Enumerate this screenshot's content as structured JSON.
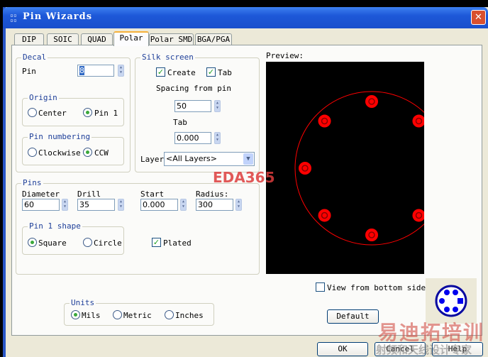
{
  "window": {
    "title": "Pin Wizards",
    "close": "✕"
  },
  "tabs": [
    {
      "label": "DIP"
    },
    {
      "label": "SOIC"
    },
    {
      "label": "QUAD"
    },
    {
      "label": "Polar",
      "active": true
    },
    {
      "label": "Polar SMD"
    },
    {
      "label": "BGA/PGA"
    }
  ],
  "decal": {
    "legend": "Decal",
    "pin_label": "Pin",
    "pin_value": "8",
    "origin": {
      "legend": "Origin",
      "options": [
        "Center",
        "Pin 1"
      ],
      "selected": "Pin 1"
    },
    "numbering": {
      "legend": "Pin numbering",
      "options": [
        "Clockwise",
        "CCW"
      ],
      "selected": "CCW"
    }
  },
  "silk": {
    "legend": "Silk screen",
    "create_label": "Create",
    "create_checked": true,
    "tab_label": "Tab",
    "tab_checked": true,
    "spacing_label": "Spacing from pin",
    "spacing_value": "50",
    "tab_value_label": "Tab",
    "tab_value": "0.000",
    "layer_label": "Layer",
    "layer_value": "<All Layers>"
  },
  "pins": {
    "legend": "Pins",
    "diameter_label": "Diameter",
    "diameter": "60",
    "drill_label": "Drill",
    "drill": "35",
    "start_label": "Start",
    "start": "0.000",
    "radius_label": "Radius:",
    "radius": "300",
    "shape": {
      "legend": "Pin 1 shape",
      "options": [
        "Square",
        "Circle"
      ],
      "selected": "Square"
    },
    "plated_label": "Plated",
    "plated_checked": true
  },
  "units": {
    "legend": "Units",
    "options": [
      "Mils",
      "Metric",
      "Inches"
    ],
    "selected": "Mils"
  },
  "preview": {
    "label": "Preview:",
    "pin_count": 8,
    "color": "#ff0000"
  },
  "view_bottom": {
    "label": "View from bottom side",
    "checked": false
  },
  "buttons": {
    "default": "Default",
    "ok": "OK",
    "cancel": "Cancel",
    "help": "Help"
  },
  "watermarks": {
    "eda": "EDA365",
    "cn1": "易迪拓培训",
    "cn2": "射频和天线设计专家"
  }
}
